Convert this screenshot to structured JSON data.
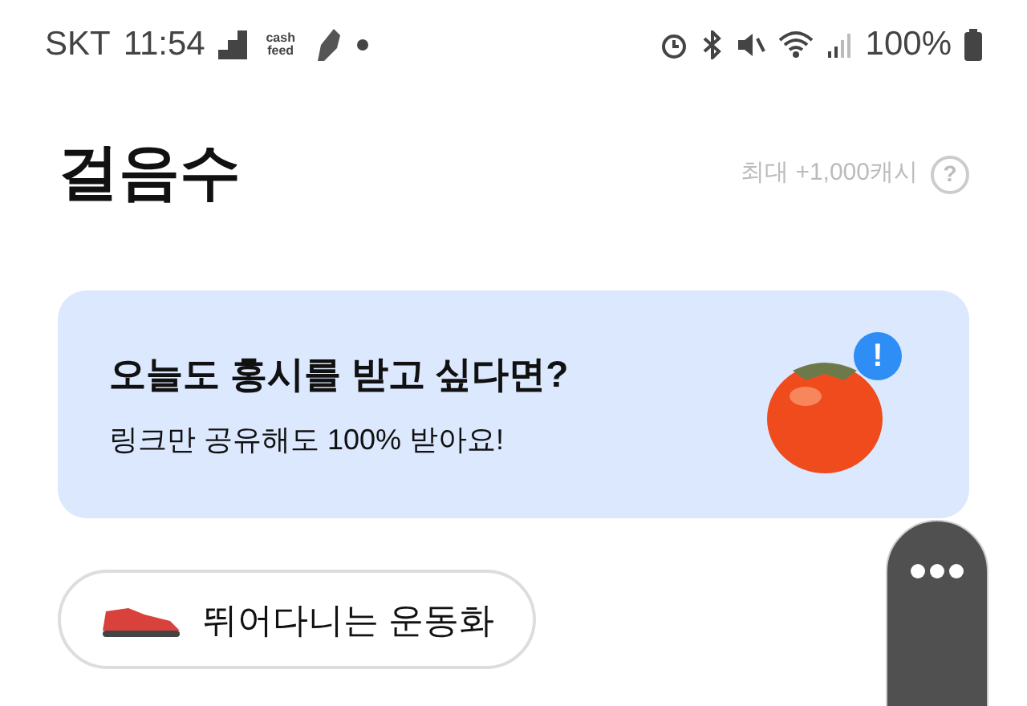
{
  "status_bar": {
    "carrier": "SKT",
    "time": "11:54",
    "app_logo": "cash feed",
    "battery": "100%"
  },
  "header": {
    "title": "걸음수",
    "reward": "최대 +1,000캐시",
    "help": "?"
  },
  "banner": {
    "title": "오늘도 홍시를 받고 싶다면?",
    "subtitle": "링크만 공유해도 100% 받아요!",
    "badge": "!"
  },
  "chip": {
    "label": "뛰어다니는 운동화"
  }
}
